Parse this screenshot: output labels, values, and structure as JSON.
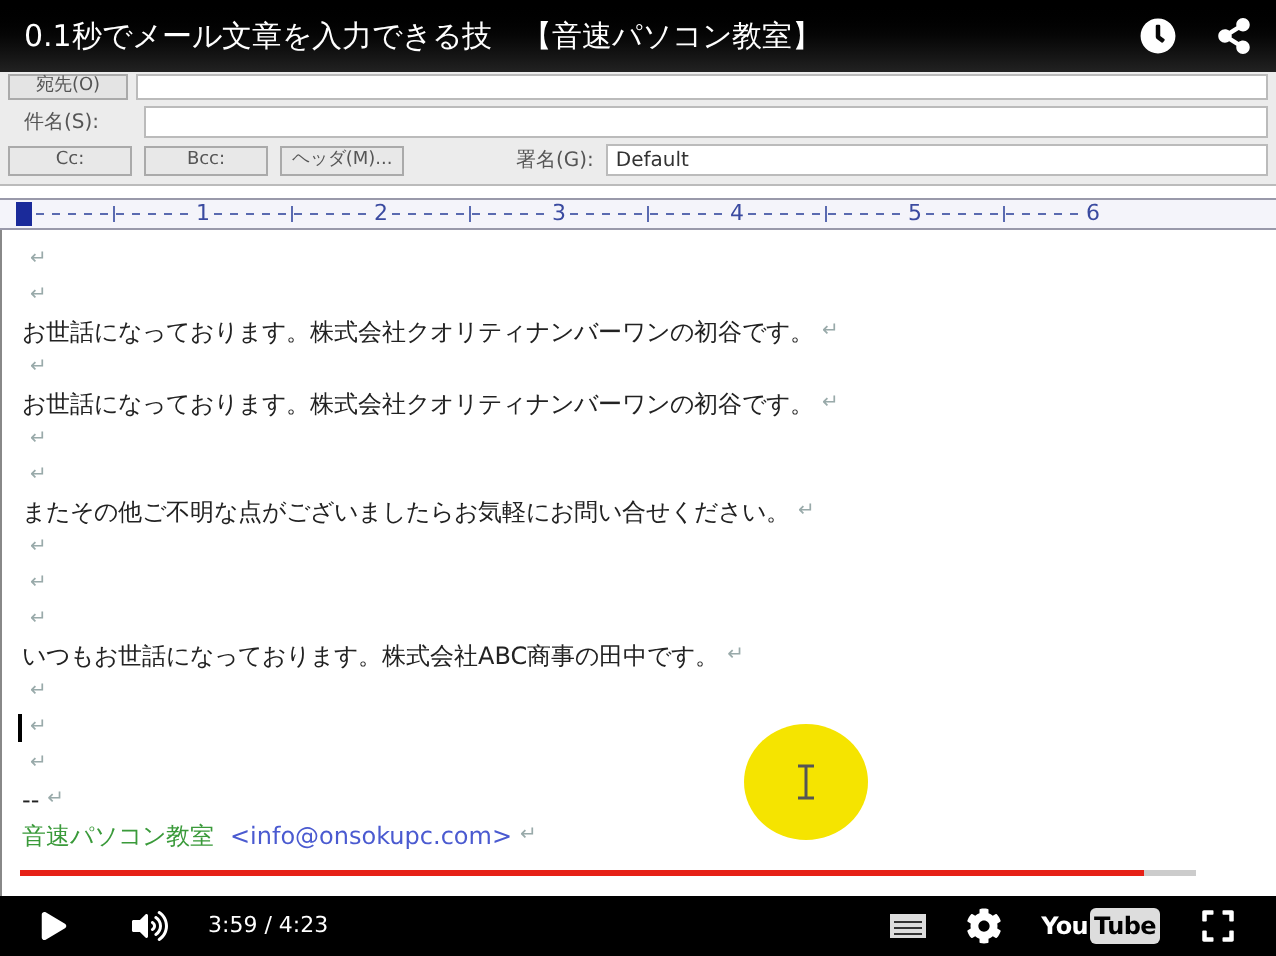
{
  "video_title": "0.1秒でメール文章を入力できる技　【音速パソコン教室】",
  "mail_header": {
    "to_button": "宛先(O)",
    "subject_label": "件名(S):",
    "buttons": [
      "Cc:",
      "Bcc:",
      "ヘッダ(M)..."
    ],
    "signature_label": "署名(G):",
    "signature_value": "Default"
  },
  "ruler": {
    "labels": [
      "1",
      "2",
      "3",
      "4",
      "5",
      "6"
    ]
  },
  "lines": [
    {
      "kind": "empty",
      "end": "↵",
      "caret": false
    },
    {
      "kind": "empty",
      "end": "↵",
      "caret": false
    },
    {
      "kind": "text",
      "text": "お世話になっております。株式会社クオリティナンバーワンの初谷です。",
      "end": "↵",
      "caret": false
    },
    {
      "kind": "empty",
      "end": "↵",
      "caret": false
    },
    {
      "kind": "text",
      "text": "お世話になっております。株式会社クオリティナンバーワンの初谷です。",
      "end": "↵",
      "caret": false
    },
    {
      "kind": "empty",
      "end": "↵",
      "caret": false
    },
    {
      "kind": "empty",
      "end": "↵",
      "caret": false
    },
    {
      "kind": "text",
      "text": "またその他ご不明な点がございましたらお気軽にお問い合せください。",
      "end": "↵",
      "caret": false
    },
    {
      "kind": "empty",
      "end": "↵",
      "caret": false
    },
    {
      "kind": "empty",
      "end": "↵",
      "caret": false
    },
    {
      "kind": "empty",
      "end": "↵",
      "caret": false
    },
    {
      "kind": "text",
      "text": "いつもお世話になっております。株式会社ABC商事の田中です。",
      "end": "↵",
      "caret": false
    },
    {
      "kind": "empty",
      "end": "↵",
      "caret": false
    },
    {
      "kind": "empty",
      "end": "↵",
      "caret": true
    },
    {
      "kind": "empty",
      "end": "↵",
      "caret": false
    },
    {
      "kind": "text",
      "text": "--",
      "end": "↵",
      "caret": false
    },
    {
      "kind": "signature",
      "name": "音速パソコン教室",
      "email": "<info@onsokupc.com>",
      "end": "↵",
      "caret": false
    }
  ],
  "player": {
    "progress": {
      "level": 0.956
    },
    "time": "3:59 / 4:23",
    "logo": {
      "you": "You",
      "tube": "Tube"
    }
  }
}
